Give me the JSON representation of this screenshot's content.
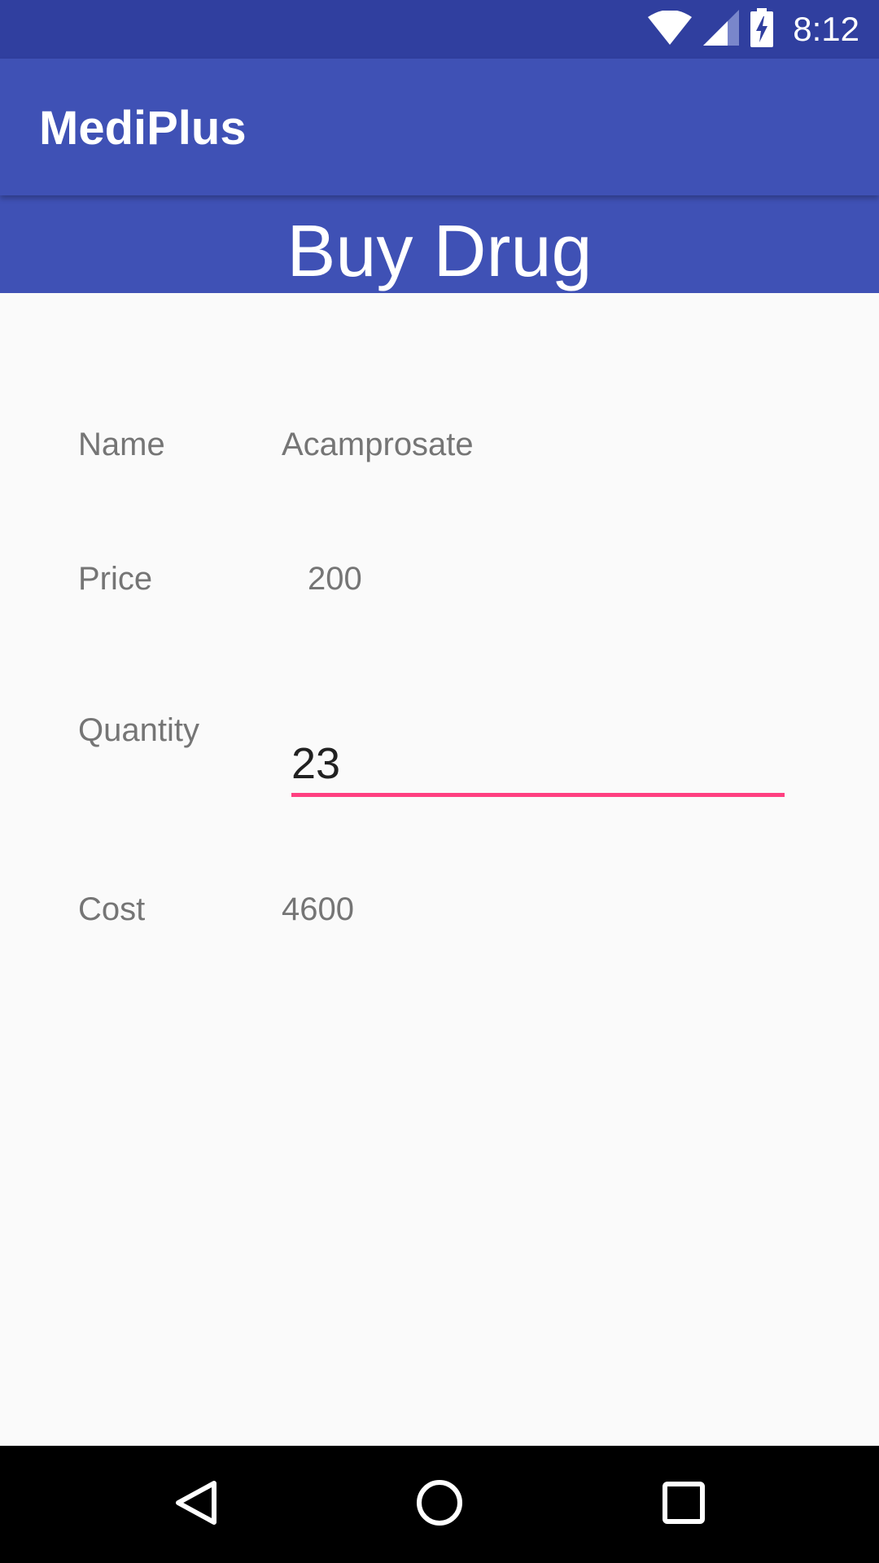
{
  "status_bar": {
    "time": "8:12",
    "icons": [
      "wifi-icon",
      "cell-signal-icon",
      "battery-charging-icon"
    ]
  },
  "app_bar": {
    "title": "MediPlus"
  },
  "page": {
    "title": "Buy Drug"
  },
  "form": {
    "name_label": "Name",
    "name_value": "Acamprosate",
    "price_label": "Price",
    "price_value": "200",
    "quantity_label": "Quantity",
    "quantity_value": "23",
    "cost_label": "Cost",
    "cost_value": "4600"
  },
  "nav_bar": {
    "icons": [
      "back-icon",
      "home-icon",
      "recents-icon"
    ]
  },
  "colors": {
    "primary": "#3f51b5",
    "primary_dark": "#303f9f",
    "accent": "#ff4081",
    "background": "#fafafa"
  }
}
